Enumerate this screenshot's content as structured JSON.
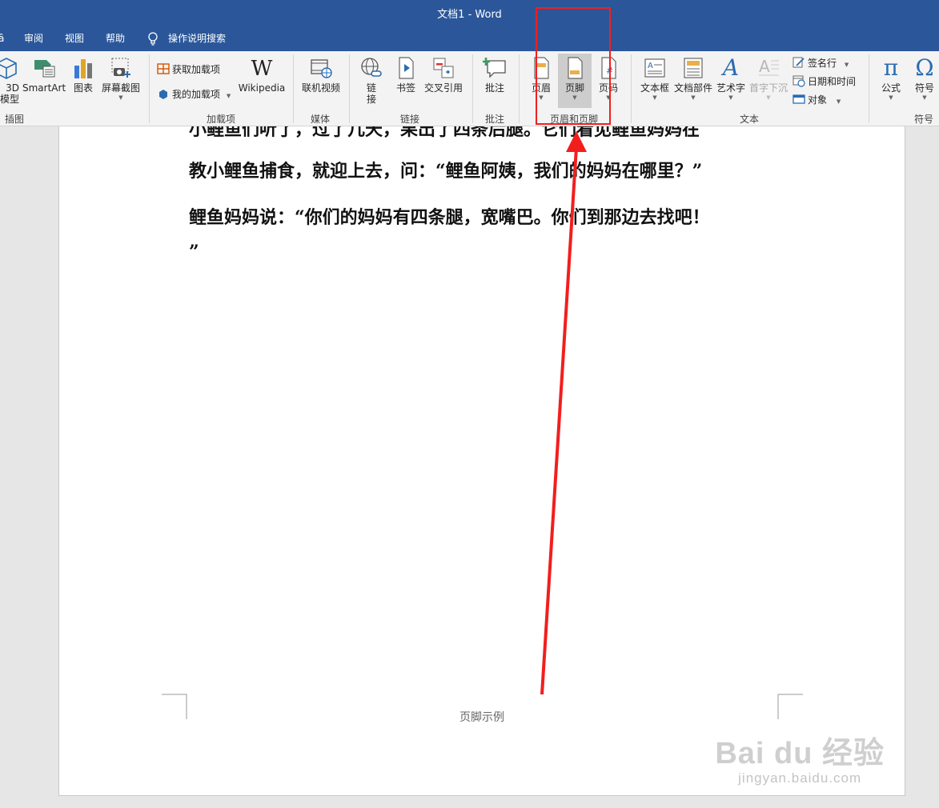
{
  "app": {
    "title": "文档1  -  Word"
  },
  "tabs": {
    "cut_prefix": "ȃ",
    "review": "审阅",
    "view": "视图",
    "help": "帮助",
    "tell_me": "操作说明搜索"
  },
  "ribbon": {
    "illustrations": {
      "model3d_line1": "3D",
      "model3d_line2": "模型",
      "smartart": "SmartArt",
      "chart": "图表",
      "screenshot": "屏幕截图",
      "group": "插图"
    },
    "addins": {
      "get_addins": "获取加载项",
      "my_addins": "我的加载项",
      "wikipedia": "Wikipedia",
      "group": "加载项"
    },
    "media": {
      "online_video": "联机视频",
      "group": "媒体"
    },
    "links": {
      "link_line1": "链",
      "link_line2": "接",
      "bookmark": "书签",
      "cross_ref": "交叉引用",
      "group": "链接"
    },
    "comments": {
      "comment": "批注",
      "group": "批注"
    },
    "header_footer": {
      "header": "页眉",
      "footer": "页脚",
      "page_number": "页码",
      "group": "页眉和页脚"
    },
    "text": {
      "textbox": "文本框",
      "quick_parts": "文档部件",
      "wordart": "艺术字",
      "dropcap": "首字下沉",
      "signature": "签名行",
      "datetime": "日期和时间",
      "object": "对象",
      "group": "文本"
    },
    "symbols": {
      "equation": "公式",
      "symbol": "符号",
      "group": "符号"
    }
  },
  "document": {
    "lines": [
      "小鲤鱼们听了，过了几天，果出了四条后腿。它们看见鲤鱼妈妈在",
      "教小鲤鱼捕食，就迎上去，问：“鲤鱼阿姨，我们的妈妈在哪里？”",
      "鲤鱼妈妈说：“你们的妈妈有四条腿，宽嘴巴。你们到那边去找吧！",
      "”"
    ],
    "footer": "页脚示例"
  },
  "watermark": {
    "brand": "Bai  du 经验",
    "url": "jingyan.baidu.com"
  },
  "colors": {
    "title_bar": "#2b579a",
    "annotation": "#f21e1e"
  }
}
